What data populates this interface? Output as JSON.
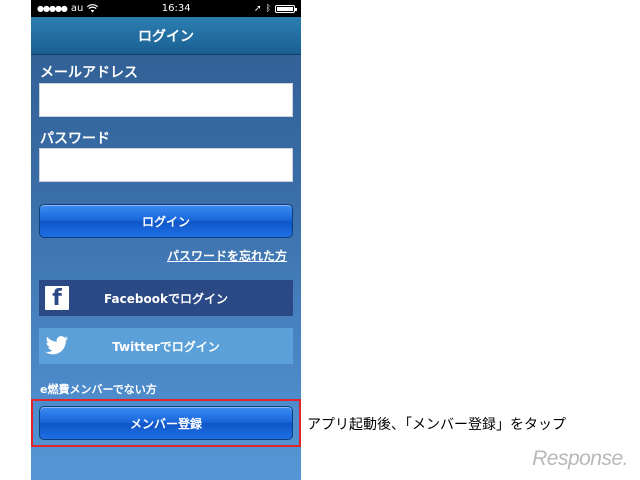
{
  "status_bar": {
    "carrier": "au",
    "time": "16:34"
  },
  "nav": {
    "title": "ログイン"
  },
  "form": {
    "email_label": "メールアドレス",
    "email_value": "",
    "password_label": "パスワード",
    "password_value": "",
    "login_button": "ログイン",
    "forgot_link": "パスワードを忘れた方"
  },
  "social": {
    "facebook_label": "Facebookでログイン",
    "twitter_label": "Twitterでログイン"
  },
  "register": {
    "prompt": "e燃費メンバーでない方",
    "button": "メンバー登録"
  },
  "annotation": {
    "caption": "アプリ起動後、「メンバー登録」をタップ",
    "highlight_color": "#e0242a"
  },
  "watermark": {
    "text": "Response."
  },
  "colors": {
    "accent_blue": "#1865db",
    "facebook": "#2b4a85",
    "twitter": "#5ba0d9"
  }
}
